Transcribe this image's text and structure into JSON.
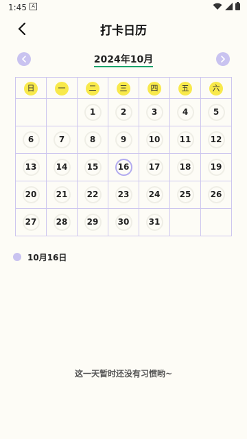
{
  "status": {
    "time": "1:45",
    "notice": "A"
  },
  "header": {
    "title": "打卡日历"
  },
  "calendar": {
    "month_label": "2024年10月",
    "weekdays": [
      "日",
      "一",
      "二",
      "三",
      "四",
      "五",
      "六"
    ],
    "weeks": [
      [
        "",
        "",
        "1",
        "2",
        "3",
        "4",
        "5"
      ],
      [
        "6",
        "7",
        "8",
        "9",
        "10",
        "11",
        "12"
      ],
      [
        "13",
        "14",
        "15",
        "16",
        "17",
        "18",
        "19"
      ],
      [
        "20",
        "21",
        "22",
        "23",
        "24",
        "25",
        "26"
      ],
      [
        "27",
        "28",
        "29",
        "30",
        "31",
        "",
        ""
      ]
    ],
    "selected_day": "16"
  },
  "selected": {
    "date_label": "10月16日"
  },
  "empty_message": "这一天暂时还没有习惯哟~",
  "colors": {
    "accent": "#c9c3f0",
    "weekday_bg": "#f8e94b",
    "underline": "#1aa26a",
    "grid": "#cdc6ef",
    "background": "#fdfcf6"
  },
  "icons": {
    "back": "chevron-left-icon",
    "prev": "chevron-left-icon",
    "next": "chevron-right-icon"
  }
}
